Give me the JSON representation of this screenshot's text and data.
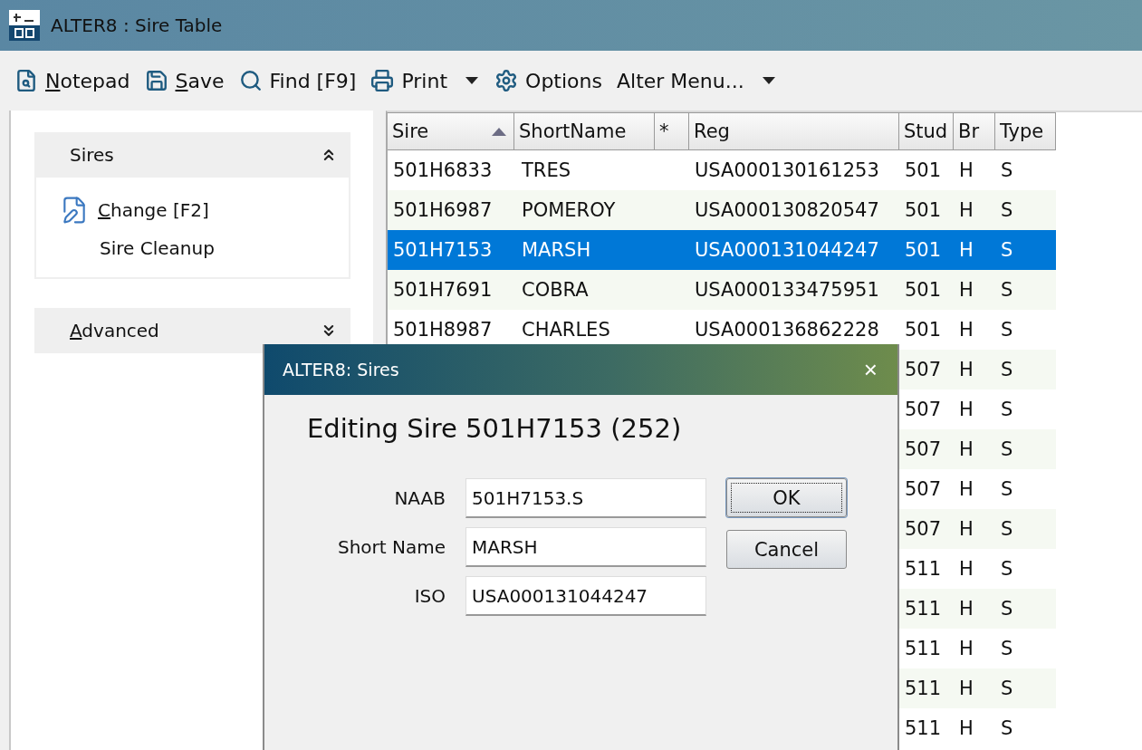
{
  "window": {
    "title": "ALTER8 : Sire Table"
  },
  "toolbar": [
    {
      "kind": "button",
      "label": "Notepad",
      "underline_first": true
    },
    {
      "kind": "button",
      "label": "Save",
      "underline_first": true
    },
    {
      "kind": "button",
      "label": "Find [F9]",
      "underline_first": false
    },
    {
      "kind": "button",
      "label": "Print",
      "underline_first": false
    },
    {
      "kind": "caret"
    },
    {
      "kind": "button",
      "label": "Options",
      "underline_first": false
    },
    {
      "kind": "button",
      "label": "Alter Menu...",
      "underline_first": false
    },
    {
      "kind": "caret"
    }
  ],
  "sidebar": {
    "sections": [
      {
        "title": "Sires",
        "expanded": true,
        "underline_first": false,
        "items": [
          {
            "label": "Change [F2]",
            "underline_first": true
          },
          {
            "label": "Sire Cleanup",
            "underline_first": false
          }
        ]
      },
      {
        "title": "Advanced",
        "expanded": false,
        "underline_first": true
      }
    ]
  },
  "table": {
    "columns": [
      {
        "label": "Sire",
        "sorted": true
      },
      {
        "label": "ShortName",
        "sorted": false
      },
      {
        "label": "*",
        "sorted": false
      },
      {
        "label": "Reg",
        "sorted": false
      },
      {
        "label": "Stud",
        "sorted": false
      },
      {
        "label": "Br",
        "sorted": false
      },
      {
        "label": "Type",
        "sorted": false
      }
    ],
    "rows": [
      {
        "cells": [
          "501H6833",
          "TRES",
          "",
          "USA000130161253",
          "501",
          "H",
          "S"
        ],
        "selected": false
      },
      {
        "cells": [
          "501H6987",
          "POMEROY",
          "",
          "USA000130820547",
          "501",
          "H",
          "S"
        ],
        "selected": false
      },
      {
        "cells": [
          "501H7153",
          "MARSH",
          "",
          "USA000131044247",
          "501",
          "H",
          "S"
        ],
        "selected": true
      },
      {
        "cells": [
          "501H7691",
          "COBRA",
          "",
          "USA000133475951",
          "501",
          "H",
          "S"
        ],
        "selected": false
      },
      {
        "cells": [
          "501H8987",
          "CHARLES",
          "",
          "USA000136862228",
          "501",
          "H",
          "S"
        ],
        "selected": false
      },
      {
        "cells": [
          "507",
          "H",
          "S"
        ],
        "selected": false
      },
      {
        "cells": [
          "507",
          "H",
          "S"
        ],
        "selected": false
      },
      {
        "cells": [
          "507",
          "H",
          "S"
        ],
        "selected": false
      },
      {
        "cells": [
          "507",
          "H",
          "S"
        ],
        "selected": false
      },
      {
        "cells": [
          "507",
          "H",
          "S"
        ],
        "selected": false
      },
      {
        "cells": [
          "511",
          "H",
          "S"
        ],
        "selected": false
      },
      {
        "cells": [
          "511",
          "H",
          "S"
        ],
        "selected": false
      },
      {
        "cells": [
          "511",
          "H",
          "S"
        ],
        "selected": false
      },
      {
        "cells": [
          "511",
          "H",
          "S"
        ],
        "selected": false
      },
      {
        "cells": [
          "511",
          "H",
          "S"
        ],
        "selected": false
      }
    ]
  },
  "dialog": {
    "title": "ALTER8: Sires",
    "close": "×",
    "heading": "Editing Sire 501H7153 (252)",
    "fields": [
      {
        "label": "NAAB",
        "value": "501H7153.S"
      },
      {
        "label": "Short Name",
        "value": "MARSH"
      },
      {
        "label": "ISO",
        "value": "USA000131044247"
      }
    ],
    "buttons": [
      {
        "label": "OK",
        "focused": true
      },
      {
        "label": "Cancel",
        "focused": false
      }
    ]
  }
}
